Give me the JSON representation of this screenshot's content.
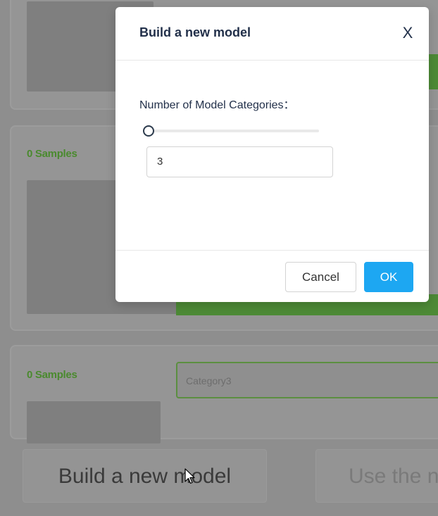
{
  "background": {
    "cards": [
      {
        "samples_label": ""
      },
      {
        "samples_label": "0 Samples"
      },
      {
        "samples_label": "0 Samples",
        "category_value": "Category3"
      }
    ],
    "build_button_label": "Build a new model",
    "use_button_label": "Use the n"
  },
  "modal": {
    "title": "Build a new model",
    "close_label": "X",
    "field_label": "Number of Model Categories：",
    "slider_value": 0,
    "input_value": "3",
    "cancel_label": "Cancel",
    "ok_label": "OK"
  },
  "colors": {
    "primary": "#1da7f2",
    "accent_green": "#4a8a2e",
    "title_text": "#22304a"
  }
}
